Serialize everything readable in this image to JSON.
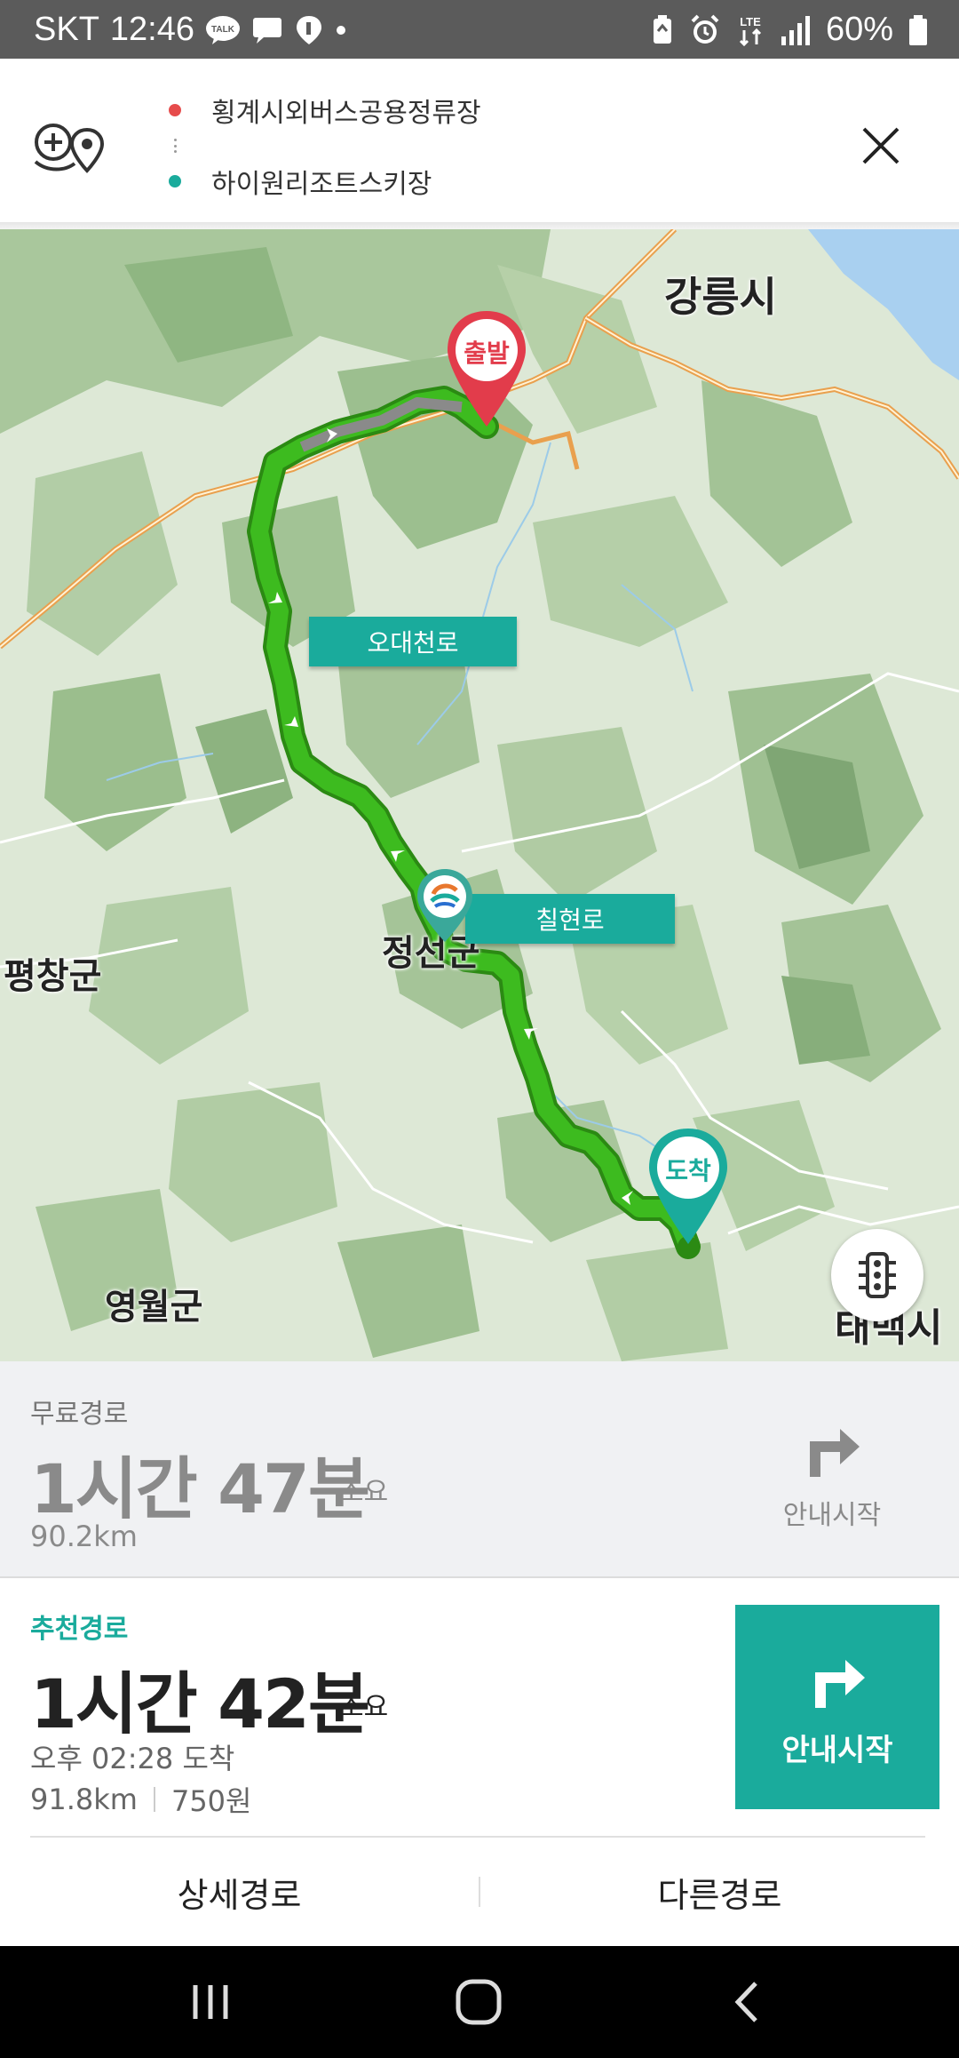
{
  "status_bar": {
    "carrier": "SKT",
    "time": "12:46",
    "talk_badge": "TALK",
    "network": "LTE",
    "battery": "60%"
  },
  "route": {
    "origin": "횡계시외버스공용정류장",
    "destination": "하이원리조트스키장"
  },
  "map": {
    "city_labels": [
      "강릉시",
      "평창군",
      "정선군",
      "영월군",
      "태백시"
    ],
    "road_labels": [
      "오대천로",
      "칠현로"
    ],
    "start_marker": "출발",
    "end_marker": "도착",
    "route_color": "#3dbb1f"
  },
  "alt_route": {
    "type": "무료경로",
    "time": "1시간 47분",
    "suffix": "소요",
    "distance": "90.2km",
    "start_label": "안내시작"
  },
  "rec_route": {
    "type": "추천경로",
    "time": "1시간 42분",
    "suffix": "소요",
    "arrival": "오후 02:28 도착",
    "distance": "91.8km",
    "toll": "750원",
    "start_label": "안내시작"
  },
  "tabs": {
    "detail": "상세경로",
    "other": "다른경로"
  },
  "colors": {
    "accent": "#1aab9c",
    "origin_dot": "#e64b4b",
    "destination_dot": "#1aab9c"
  }
}
